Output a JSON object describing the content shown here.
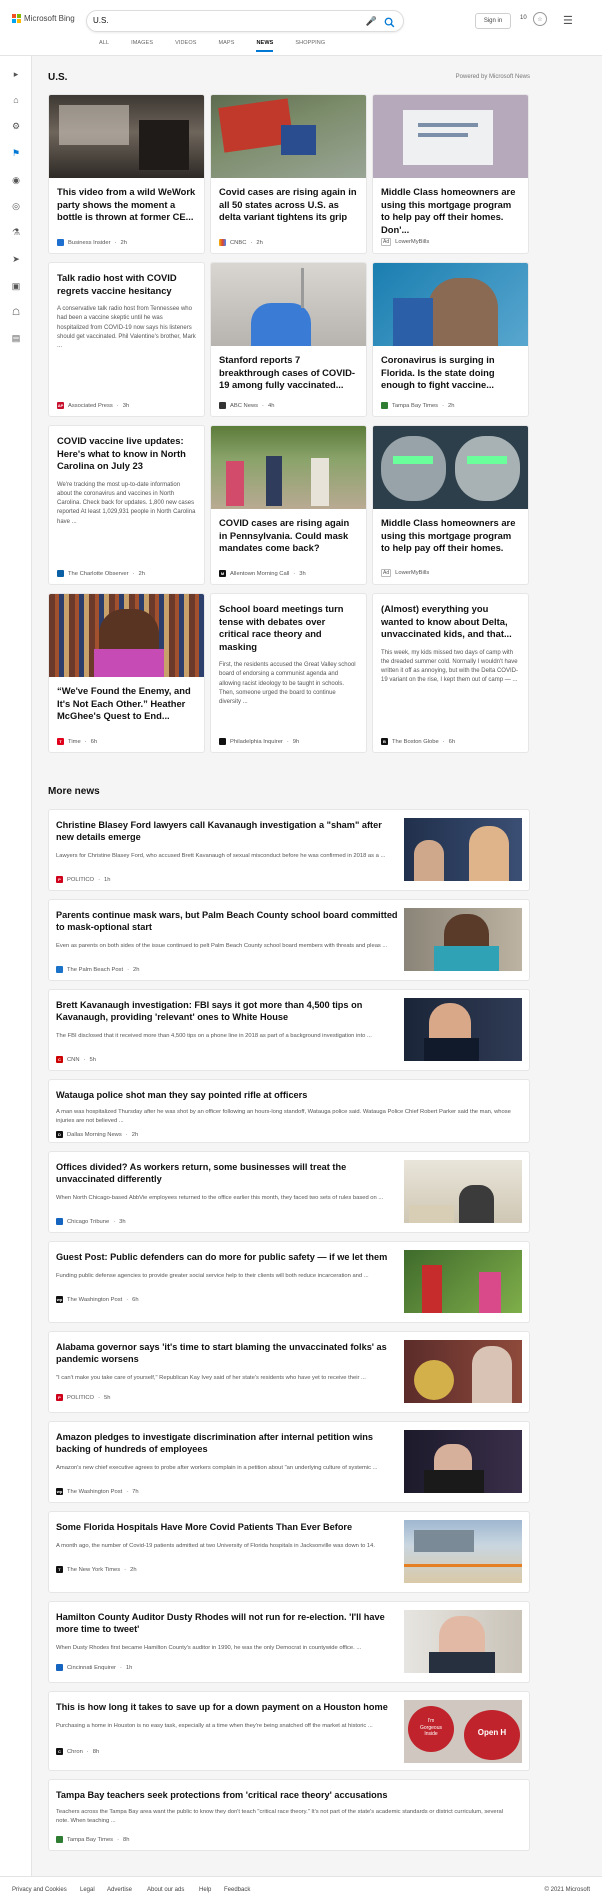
{
  "header": {
    "brand": "Microsoft Bing",
    "search_query": "U.S.",
    "signin_label": "Sign in",
    "rewards_count": "10",
    "tabs": [
      "ALL",
      "IMAGES",
      "VIDEOS",
      "MAPS",
      "NEWS",
      "SHOPPING"
    ],
    "active_tab": "NEWS"
  },
  "section": {
    "title": "U.S.",
    "powered_by": "Powered by Microsoft News"
  },
  "cards": [
    {
      "title": "This video from a wild WeWork party shows the moment a bottle is thrown at former CE...",
      "source": "Business Insider",
      "time": "2h"
    },
    {
      "title": "Covid cases are rising again in all 50 states across U.S. as delta variant tightens its grip",
      "source": "CNBC",
      "time": "2h"
    },
    {
      "title": "Middle Class homeowners are using this mortgage program to help pay off their homes. Don'...",
      "ad": "Ad",
      "source": "LowerMyBills"
    },
    {
      "title": "Talk radio host with COVID regrets vaccine hesitancy",
      "snippet": "A conservative talk radio host from Tennessee who had been a vaccine skeptic until he was hospitalized from COVID-19 now says his listeners should get vaccinated. Phil Valentine's brother, Mark ...",
      "source": "Associated Press",
      "time": "3h"
    },
    {
      "title": "Stanford reports 7 breakthrough cases of COVID-19 among fully vaccinated...",
      "source": "ABC News",
      "time": "4h"
    },
    {
      "title": "Coronavirus is surging in Florida. Is the state doing enough to fight vaccine...",
      "source": "Tampa Bay Times",
      "time": "2h"
    },
    {
      "title": "COVID vaccine live updates: Here's what to know in North Carolina on July 23",
      "snippet": "We're tracking the most up-to-date information about the coronavirus and vaccines in North Carolina. Check back for updates. 1,800 new cases reported At least 1,029,931 people in North Carolina have ...",
      "source": "The Charlotte Observer",
      "time": "2h"
    },
    {
      "title": "COVID cases are rising again in Pennsylvania. Could mask mandates come back?",
      "source": "Allentown Morning Call",
      "time": "3h"
    },
    {
      "title": "Middle Class homeowners are using this mortgage program to help pay off their homes.",
      "ad": "Ad",
      "source": "LowerMyBills"
    },
    {
      "title": "“We've Found the Enemy, and It's Not Each Other.” Heather McGhee's Quest to End...",
      "source": "Time",
      "time": "6h"
    },
    {
      "title": "School board meetings turn tense with debates over critical race theory and masking",
      "snippet": "First, the residents accused the Great Valley school board of endorsing a communist agenda and allowing racist ideology to be taught in schools. Then, someone urged the board to continue diversity ...",
      "source": "Philadelphia Inquirer",
      "time": "9h"
    },
    {
      "title": "(Almost) everything you wanted to know about Delta, unvaccinated kids, and that...",
      "snippet": "This week, my kids missed two days of camp with the dreaded summer cold. Normally I wouldn't have written it off as annoying, but with the Delta COVID-19 variant on the rise, I kept them out of camp — ...",
      "source": "The Boston Globe",
      "time": "6h"
    }
  ],
  "more_news": {
    "title": "More news",
    "items": [
      {
        "title": "Christine Blasey Ford lawyers call Kavanaugh investigation a \"sham\" after new details emerge",
        "snippet": "Lawyers for Christine Blasey Ford, who accused Brett Kavanaugh of sexual misconduct before he was confirmed in 2018 as a ...",
        "source": "POLITICO",
        "time": "1h"
      },
      {
        "title": "Parents continue mask wars, but Palm Beach County school board committed to mask-optional start",
        "snippet": "Even as parents on both sides of the issue continued to pelt Palm Beach County school board members with threats and pleas ...",
        "source": "The Palm Beach Post",
        "time": "2h"
      },
      {
        "title": "Brett Kavanaugh investigation: FBI says it got more than 4,500 tips on Kavanaugh, providing 'relevant' ones to White House",
        "snippet": "The FBI disclosed that it received more than 4,500 tips on a phone line in 2018 as part of a background investigation into ...",
        "source": "CNN",
        "time": "5h"
      },
      {
        "title": "Watauga police shot man they say pointed rifle at officers",
        "snippet": "A man was hospitalized Thursday after he was shot by an officer following an hours-long standoff, Watauga police said. Watauga Police Chief Robert Parker said the man, whose injuries are not believed ...",
        "source": "Dallas Morning News",
        "time": "2h"
      },
      {
        "title": "Offices divided? As workers return, some businesses will treat the unvaccinated differently",
        "snippet": "When North Chicago-based AbbVie employees returned to the office earlier this month, they faced two sets of rules based on ...",
        "source": "Chicago Tribune",
        "time": "3h"
      },
      {
        "title": "Guest Post: Public defenders can do more for public safety — if we let them",
        "snippet": "Funding public defense agencies to provide greater social service help to their clients will both reduce incarceration and ...",
        "source": "The Washington Post",
        "time": "6h"
      },
      {
        "title": "Alabama governor says 'it's time to start blaming the unvaccinated folks' as pandemic worsens",
        "snippet": "\"I can't make you take care of yourself,\" Republican Kay Ivey said of her state's residents who have yet to receive their ...",
        "source": "POLITICO",
        "time": "5h"
      },
      {
        "title": "Amazon pledges to investigate discrimination after internal petition wins backing of hundreds of employees",
        "snippet": "Amazon's new chief executive agrees to probe after workers complain in a petition about \"an underlying culture of systemic ...",
        "source": "The Washington Post",
        "time": "7h"
      },
      {
        "title": "Some Florida Hospitals Have More Covid Patients Than Ever Before",
        "snippet": "A month ago, the number of Covid-19 patients admitted at two University of Florida hospitals in Jacksonville was down to 14.",
        "source": "The New York Times",
        "time": "2h"
      },
      {
        "title": "Hamilton County Auditor Dusty Rhodes will not run for re-election. 'I'll have more time to tweet'",
        "snippet": "When Dusty Rhodes first became Hamilton County's auditor in 1990, he was the only Democrat in countywide office. ...",
        "source": "Cincinnati Enquirer",
        "time": "1h"
      },
      {
        "title": "This is how long it takes to save up for a down payment on a Houston home",
        "snippet": "Purchasing a home in Houston is no easy task, especially at a time when they're being snatched off the market at historic ...",
        "source": "Chron",
        "time": "8h",
        "image_text": [
          "I'm",
          "Gorgeous",
          "Inside",
          "Open H"
        ]
      },
      {
        "title": "Tampa Bay teachers seek protections from 'critical race theory' accusations",
        "snippet": "Teachers across the Tampa Bay area want the public to know they don't teach \"critical race theory.\" It's not part of the state's academic standards or district curriculum, several note. When teaching ...",
        "source": "Tampa Bay Times",
        "time": "8h"
      }
    ]
  },
  "footer": {
    "links": [
      "Privacy and Cookies",
      "Legal",
      "Advertise",
      "About our ads",
      "Help",
      "Feedback"
    ],
    "copyright": "© 2021 Microsoft"
  },
  "colors": {
    "accent": "#0078d4",
    "background": "#f5f5f5",
    "card": "#ffffff"
  },
  "icons": [
    "microsoft-logo-icon",
    "microphone-icon",
    "search-icon",
    "trophy-icon",
    "hamburger-menu-icon",
    "expand-icon",
    "home-icon",
    "sports-icon",
    "flag-icon",
    "location-icon",
    "globe-icon",
    "science-icon",
    "rocket-icon",
    "entertainment-icon",
    "bank-icon",
    "money-icon"
  ]
}
